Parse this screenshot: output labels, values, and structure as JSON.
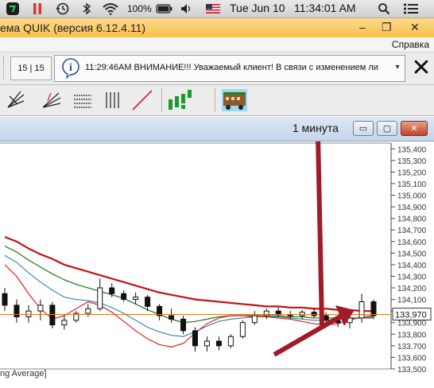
{
  "menubar": {
    "battery": "100%",
    "date": "Tue Jun 10",
    "time": "11:34:01 AM"
  },
  "window": {
    "title": "ема QUIK (версия 6.12.4.11)",
    "minimize": "–",
    "restore": "❐",
    "close": "✕"
  },
  "menu": {
    "help": "Справка"
  },
  "ticker": {
    "page_indicator": "15 | 15",
    "news_text": "11:29:46AM  ВНИМАНИЕ!!!  Уважаемый клиент! В связи с изменением ли",
    "dropdown": "▾",
    "close_glyph": "✕"
  },
  "chart_window": {
    "period": "1 минута",
    "btn_minimize": "▭",
    "btn_restore": "▢",
    "btn_close": "✕",
    "indicator_label": "ng Average]"
  },
  "colors": {
    "candle_body": "#111111",
    "ma_fast": "#e0201a",
    "ma_mid": "#1f6fa8",
    "ma_slow": "#207020",
    "ma_long": "#c01414",
    "current_price_line": "#e07a1a",
    "annotation_arrow": "#a01a2a"
  },
  "chart_data": {
    "type": "candlestick",
    "y_axis_ticks": [
      "135,400",
      "135,300",
      "135,200",
      "135,100",
      "135,000",
      "134,900",
      "134,800",
      "134,700",
      "134,600",
      "134,500",
      "134,400",
      "134,300",
      "134,200",
      "134,100",
      "134,000",
      "133,900",
      "133,800",
      "133,700",
      "133,600",
      "133,500"
    ],
    "ylim": [
      133500,
      135450
    ],
    "current_price": "133,970",
    "current_price_value": 133970,
    "ma_long": [
      134640,
      134600,
      134540,
      134490,
      134450,
      134400,
      134370,
      134340,
      134310,
      134280,
      134250,
      134220,
      134190,
      134160,
      134140,
      134120,
      134100,
      134090,
      134080,
      134070,
      134060,
      134050,
      134040,
      134040,
      134030,
      134030,
      134020,
      134020,
      134010,
      134010,
      134000,
      134000
    ],
    "ma_slow": [
      134560,
      134510,
      134440,
      134380,
      134320,
      134270,
      134230,
      134200,
      134170,
      134140,
      134110,
      134060,
      134010,
      133970,
      133930,
      133900,
      133910,
      133930,
      133950,
      133960,
      133960,
      133960,
      133960,
      133960,
      133950,
      133950,
      133940,
      133940,
      133940,
      133940,
      133940,
      133940
    ],
    "ma_mid": [
      134480,
      134420,
      134330,
      134250,
      134180,
      134120,
      134100,
      134090,
      134070,
      134030,
      133980,
      133920,
      133860,
      133820,
      133790,
      133780,
      133820,
      133870,
      133910,
      133930,
      133940,
      133950,
      133950,
      133950,
      133940,
      133930,
      133920,
      133920,
      133930,
      133930,
      133940,
      133950
    ],
    "ma_fast": [
      134400,
      134300,
      134150,
      134020,
      133930,
      133960,
      134020,
      134080,
      134050,
      133990,
      133910,
      133830,
      133760,
      133710,
      133690,
      133720,
      133810,
      133890,
      133940,
      133960,
      133960,
      133950,
      133950,
      133940,
      133930,
      133910,
      133890,
      133880,
      133890,
      133920,
      133950,
      133960
    ],
    "candles": [
      {
        "o": 134150,
        "h": 134200,
        "l": 134000,
        "c": 134050
      },
      {
        "o": 134050,
        "h": 134100,
        "l": 133900,
        "c": 133950
      },
      {
        "o": 133950,
        "h": 134050,
        "l": 133900,
        "c": 134000
      },
      {
        "o": 134000,
        "h": 134100,
        "l": 133920,
        "c": 134050
      },
      {
        "o": 134050,
        "h": 134080,
        "l": 133850,
        "c": 133880
      },
      {
        "o": 133880,
        "h": 133960,
        "l": 133840,
        "c": 133920
      },
      {
        "o": 133920,
        "h": 134000,
        "l": 133900,
        "c": 133980
      },
      {
        "o": 133980,
        "h": 134060,
        "l": 133950,
        "c": 134020
      },
      {
        "o": 134020,
        "h": 134280,
        "l": 134000,
        "c": 134200
      },
      {
        "o": 134200,
        "h": 134240,
        "l": 134120,
        "c": 134150
      },
      {
        "o": 134150,
        "h": 134180,
        "l": 134080,
        "c": 134100
      },
      {
        "o": 134100,
        "h": 134160,
        "l": 134060,
        "c": 134120
      },
      {
        "o": 134120,
        "h": 134140,
        "l": 134000,
        "c": 134040
      },
      {
        "o": 134040,
        "h": 134060,
        "l": 133920,
        "c": 133960
      },
      {
        "o": 133960,
        "h": 134020,
        "l": 133900,
        "c": 133930
      },
      {
        "o": 133930,
        "h": 133960,
        "l": 133800,
        "c": 133830
      },
      {
        "o": 133830,
        "h": 133860,
        "l": 133650,
        "c": 133700
      },
      {
        "o": 133700,
        "h": 133780,
        "l": 133650,
        "c": 133740
      },
      {
        "o": 133740,
        "h": 133780,
        "l": 133660,
        "c": 133700
      },
      {
        "o": 133700,
        "h": 133800,
        "l": 133680,
        "c": 133780
      },
      {
        "o": 133780,
        "h": 133920,
        "l": 133760,
        "c": 133900
      },
      {
        "o": 133900,
        "h": 134000,
        "l": 133880,
        "c": 133960
      },
      {
        "o": 133960,
        "h": 134020,
        "l": 133930,
        "c": 134000
      },
      {
        "o": 134000,
        "h": 134030,
        "l": 133950,
        "c": 133970
      },
      {
        "o": 133970,
        "h": 134000,
        "l": 133930,
        "c": 133960
      },
      {
        "o": 133960,
        "h": 134010,
        "l": 133930,
        "c": 133990
      },
      {
        "o": 133990,
        "h": 134020,
        "l": 133940,
        "c": 133960
      },
      {
        "o": 133960,
        "h": 133990,
        "l": 133890,
        "c": 133920
      },
      {
        "o": 133920,
        "h": 133960,
        "l": 133860,
        "c": 133900
      },
      {
        "o": 133900,
        "h": 133950,
        "l": 133850,
        "c": 133940
      },
      {
        "o": 133940,
        "h": 134150,
        "l": 133900,
        "c": 134080
      },
      {
        "o": 134080,
        "h": 134100,
        "l": 133930,
        "c": 133960
      }
    ]
  }
}
